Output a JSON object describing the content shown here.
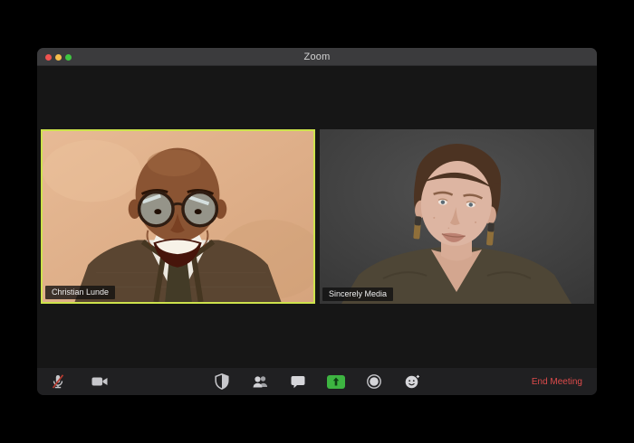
{
  "window": {
    "title": "Zoom",
    "traffic_lights": [
      "close",
      "minimize",
      "fullscreen"
    ]
  },
  "participants": [
    {
      "name": "Christian Lunde",
      "active_speaker": true
    },
    {
      "name": "Sincerely Media",
      "active_speaker": false
    }
  ],
  "toolbar": {
    "buttons": [
      {
        "name": "mute",
        "icon": "microphone-muted-icon",
        "state": "muted"
      },
      {
        "name": "video",
        "icon": "camera-icon",
        "state": "on"
      },
      {
        "name": "security",
        "icon": "shield-icon"
      },
      {
        "name": "participants",
        "icon": "people-icon"
      },
      {
        "name": "chat",
        "icon": "chat-bubble-icon"
      },
      {
        "name": "share-screen",
        "icon": "share-screen-arrow-icon"
      },
      {
        "name": "record",
        "icon": "record-circle-icon"
      },
      {
        "name": "reactions",
        "icon": "reactions-smiley-icon"
      }
    ],
    "end_meeting_label": "End Meeting"
  },
  "colors": {
    "active_speaker_border": "#cde24c",
    "share_button_green": "#3db441",
    "end_meeting_red": "#de4b4b",
    "traffic_red": "#ee5350",
    "traffic_yellow": "#f5bd4c",
    "traffic_green": "#3fc641"
  }
}
